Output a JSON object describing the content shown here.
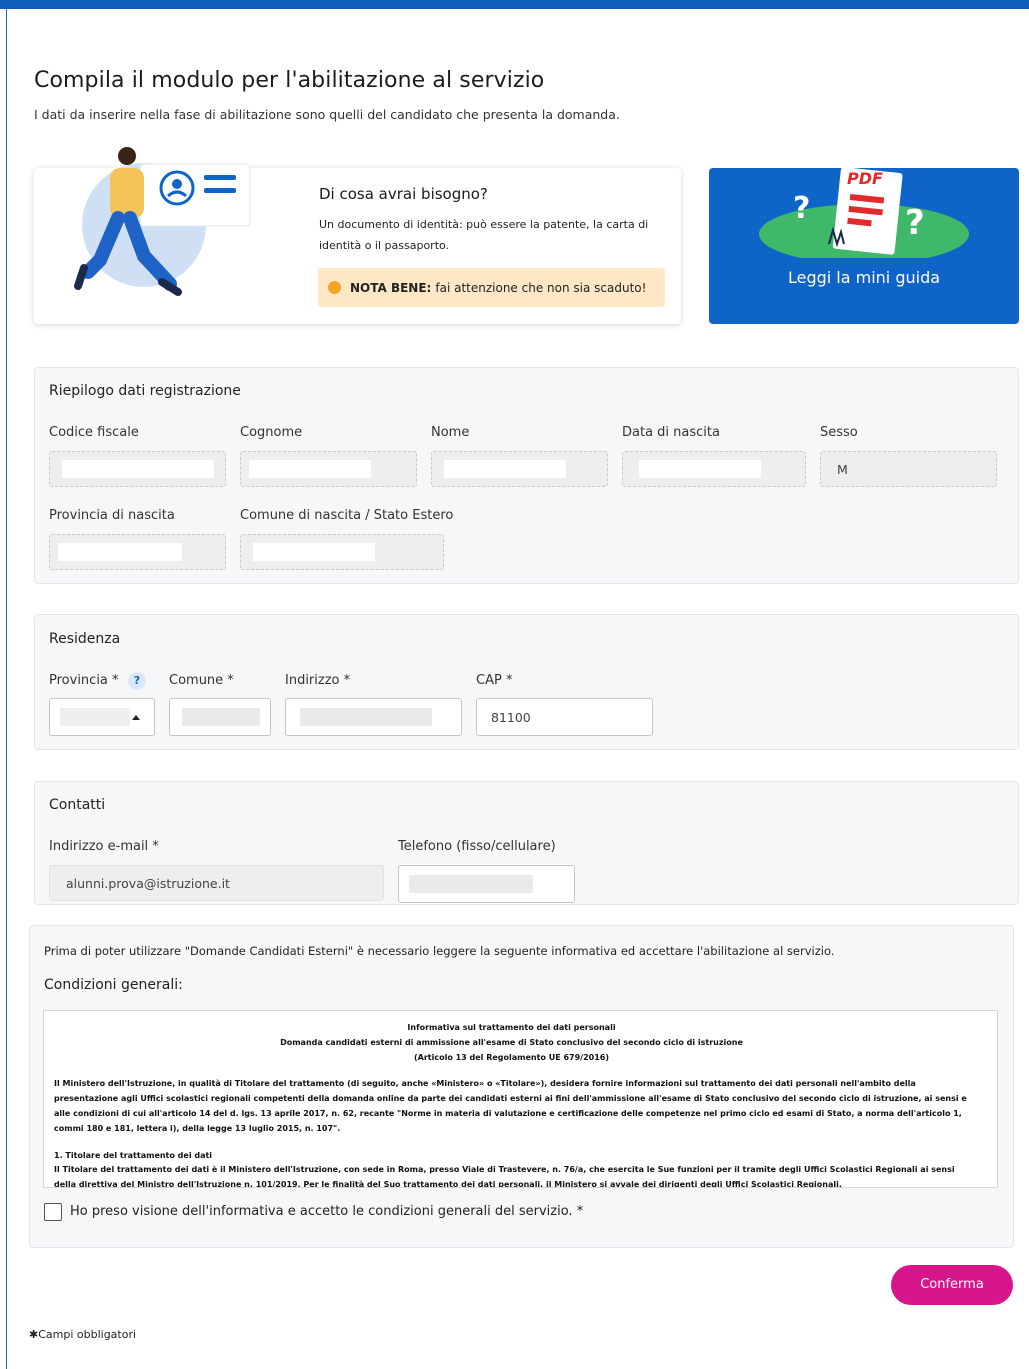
{
  "header": {
    "title": "Compila il modulo per l'abilitazione al servizio",
    "subtitle": "I dati da inserire nella fase di abilitazione sono quelli del candidato che presenta la domanda."
  },
  "need": {
    "title": "Di cosa avrai bisogno?",
    "text": "Un documento di identità: può essere la patente, la carta di identità o il passaporto.",
    "note_bold": "NOTA BENE:",
    "note_text": "fai attenzione che non sia scaduto!"
  },
  "guide": {
    "pdf_label": "PDF",
    "label": "Leggi la mini guida"
  },
  "riepilogo": {
    "title": "Riepilogo dati registrazione",
    "fields": {
      "codice_fiscale": "Codice fiscale",
      "cognome": "Cognome",
      "nome": "Nome",
      "data_nascita": "Data di nascita",
      "sesso": "Sesso",
      "sesso_value": "M",
      "provincia_nascita": "Provincia di nascita",
      "comune_nascita": "Comune di nascita / Stato Estero"
    }
  },
  "residenza": {
    "title": "Residenza",
    "provincia": "Provincia *",
    "help": "?",
    "comune": "Comune *",
    "indirizzo": "Indirizzo *",
    "cap": "CAP *",
    "cap_value": "81100"
  },
  "contatti": {
    "title": "Contatti",
    "email_label": "Indirizzo e-mail *",
    "email_value": "alunni.prova@istruzione.it",
    "telefono_label": "Telefono (fisso/cellulare)"
  },
  "terms": {
    "intro": "Prima di poter utilizzare \"Domande Candidati Esterni\" è necessario leggere la seguente informativa ed accettare l'abilitazione al servizio.",
    "title": "Condizioni generali:",
    "doc_title1": "Informativa sul trattamento dei dati personali",
    "doc_title2": "Domanda candidati esterni di ammissione all'esame di Stato conclusivo del secondo ciclo di istruzione",
    "doc_title3": "(Articolo 13 del Regolamento UE 679/2016)",
    "para1": "Il Ministero dell'Istruzione, in qualità di Titolare del trattamento (di seguito, anche «Ministero» o «Titolare»), desidera fornire informazioni sul trattamento dei dati personali nell'ambito della presentazione agli Uffici scolastici regionali competenti della domanda online da parte dei candidati esterni ai fini dell'ammissione all'esame di Stato conclusivo del secondo ciclo di istruzione, ai sensi e alle condizioni di cui all'articolo 14 del d. lgs. 13 aprile 2017, n. 62, recante \"Norme in materia di valutazione e certificazione delle competenze nel primo ciclo ed esami di Stato, a norma dell'articolo 1, commi 180 e 181, lettera i), della legge 13 luglio 2015, n. 107\".",
    "section1": "1. Titolare del trattamento dei dati",
    "para2": "Il Titolare del trattamento dei dati è il Ministero dell'Istruzione, con sede in Roma, presso Viale di Trastevere, n. 76/a, che esercita le Sue funzioni per il tramite degli Uffici Scolastici Regionali ai sensi della direttiva del Ministro dell'Istruzione n. 101/2019. Per le finalità del Suo trattamento dei dati personali, il Ministero si avvale dei dirigenti degli Uffici Scolastici Regionali.",
    "accept": "Ho preso visione dell'informativa e accetto le condizioni generali del servizio. *"
  },
  "actions": {
    "confirm": "Conferma"
  },
  "footer": {
    "required": "Campi obbligatori"
  },
  "colors": {
    "primary": "#0f64c8",
    "accent": "#d6168a",
    "note_bg": "#fde7c5"
  }
}
